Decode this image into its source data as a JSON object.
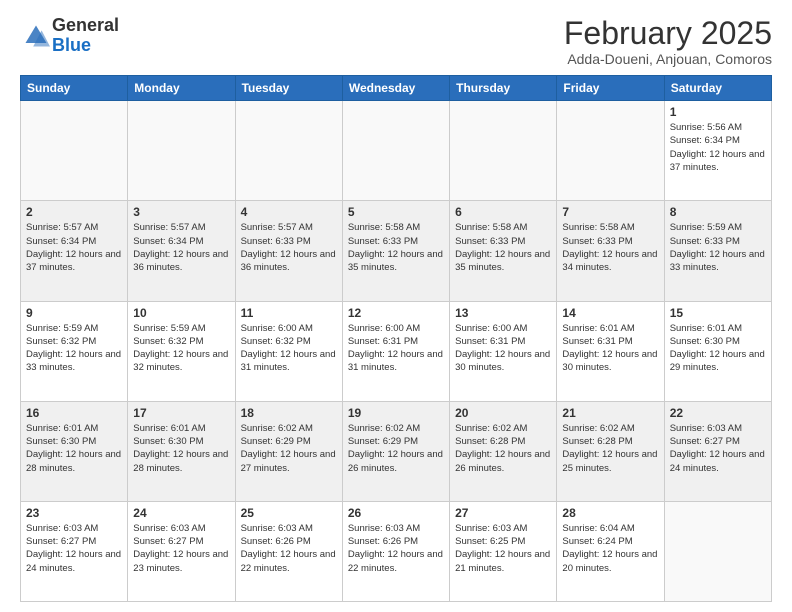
{
  "logo": {
    "general": "General",
    "blue": "Blue"
  },
  "header": {
    "month": "February 2025",
    "location": "Adda-Doueni, Anjouan, Comoros"
  },
  "weekdays": [
    "Sunday",
    "Monday",
    "Tuesday",
    "Wednesday",
    "Thursday",
    "Friday",
    "Saturday"
  ],
  "weeks": [
    [
      {
        "day": "",
        "info": ""
      },
      {
        "day": "",
        "info": ""
      },
      {
        "day": "",
        "info": ""
      },
      {
        "day": "",
        "info": ""
      },
      {
        "day": "",
        "info": ""
      },
      {
        "day": "",
        "info": ""
      },
      {
        "day": "1",
        "info": "Sunrise: 5:56 AM\nSunset: 6:34 PM\nDaylight: 12 hours and 37 minutes."
      }
    ],
    [
      {
        "day": "2",
        "info": "Sunrise: 5:57 AM\nSunset: 6:34 PM\nDaylight: 12 hours and 37 minutes."
      },
      {
        "day": "3",
        "info": "Sunrise: 5:57 AM\nSunset: 6:34 PM\nDaylight: 12 hours and 36 minutes."
      },
      {
        "day": "4",
        "info": "Sunrise: 5:57 AM\nSunset: 6:33 PM\nDaylight: 12 hours and 36 minutes."
      },
      {
        "day": "5",
        "info": "Sunrise: 5:58 AM\nSunset: 6:33 PM\nDaylight: 12 hours and 35 minutes."
      },
      {
        "day": "6",
        "info": "Sunrise: 5:58 AM\nSunset: 6:33 PM\nDaylight: 12 hours and 35 minutes."
      },
      {
        "day": "7",
        "info": "Sunrise: 5:58 AM\nSunset: 6:33 PM\nDaylight: 12 hours and 34 minutes."
      },
      {
        "day": "8",
        "info": "Sunrise: 5:59 AM\nSunset: 6:33 PM\nDaylight: 12 hours and 33 minutes."
      }
    ],
    [
      {
        "day": "9",
        "info": "Sunrise: 5:59 AM\nSunset: 6:32 PM\nDaylight: 12 hours and 33 minutes."
      },
      {
        "day": "10",
        "info": "Sunrise: 5:59 AM\nSunset: 6:32 PM\nDaylight: 12 hours and 32 minutes."
      },
      {
        "day": "11",
        "info": "Sunrise: 6:00 AM\nSunset: 6:32 PM\nDaylight: 12 hours and 31 minutes."
      },
      {
        "day": "12",
        "info": "Sunrise: 6:00 AM\nSunset: 6:31 PM\nDaylight: 12 hours and 31 minutes."
      },
      {
        "day": "13",
        "info": "Sunrise: 6:00 AM\nSunset: 6:31 PM\nDaylight: 12 hours and 30 minutes."
      },
      {
        "day": "14",
        "info": "Sunrise: 6:01 AM\nSunset: 6:31 PM\nDaylight: 12 hours and 30 minutes."
      },
      {
        "day": "15",
        "info": "Sunrise: 6:01 AM\nSunset: 6:30 PM\nDaylight: 12 hours and 29 minutes."
      }
    ],
    [
      {
        "day": "16",
        "info": "Sunrise: 6:01 AM\nSunset: 6:30 PM\nDaylight: 12 hours and 28 minutes."
      },
      {
        "day": "17",
        "info": "Sunrise: 6:01 AM\nSunset: 6:30 PM\nDaylight: 12 hours and 28 minutes."
      },
      {
        "day": "18",
        "info": "Sunrise: 6:02 AM\nSunset: 6:29 PM\nDaylight: 12 hours and 27 minutes."
      },
      {
        "day": "19",
        "info": "Sunrise: 6:02 AM\nSunset: 6:29 PM\nDaylight: 12 hours and 26 minutes."
      },
      {
        "day": "20",
        "info": "Sunrise: 6:02 AM\nSunset: 6:28 PM\nDaylight: 12 hours and 26 minutes."
      },
      {
        "day": "21",
        "info": "Sunrise: 6:02 AM\nSunset: 6:28 PM\nDaylight: 12 hours and 25 minutes."
      },
      {
        "day": "22",
        "info": "Sunrise: 6:03 AM\nSunset: 6:27 PM\nDaylight: 12 hours and 24 minutes."
      }
    ],
    [
      {
        "day": "23",
        "info": "Sunrise: 6:03 AM\nSunset: 6:27 PM\nDaylight: 12 hours and 24 minutes."
      },
      {
        "day": "24",
        "info": "Sunrise: 6:03 AM\nSunset: 6:27 PM\nDaylight: 12 hours and 23 minutes."
      },
      {
        "day": "25",
        "info": "Sunrise: 6:03 AM\nSunset: 6:26 PM\nDaylight: 12 hours and 22 minutes."
      },
      {
        "day": "26",
        "info": "Sunrise: 6:03 AM\nSunset: 6:26 PM\nDaylight: 12 hours and 22 minutes."
      },
      {
        "day": "27",
        "info": "Sunrise: 6:03 AM\nSunset: 6:25 PM\nDaylight: 12 hours and 21 minutes."
      },
      {
        "day": "28",
        "info": "Sunrise: 6:04 AM\nSunset: 6:24 PM\nDaylight: 12 hours and 20 minutes."
      },
      {
        "day": "",
        "info": ""
      }
    ]
  ]
}
